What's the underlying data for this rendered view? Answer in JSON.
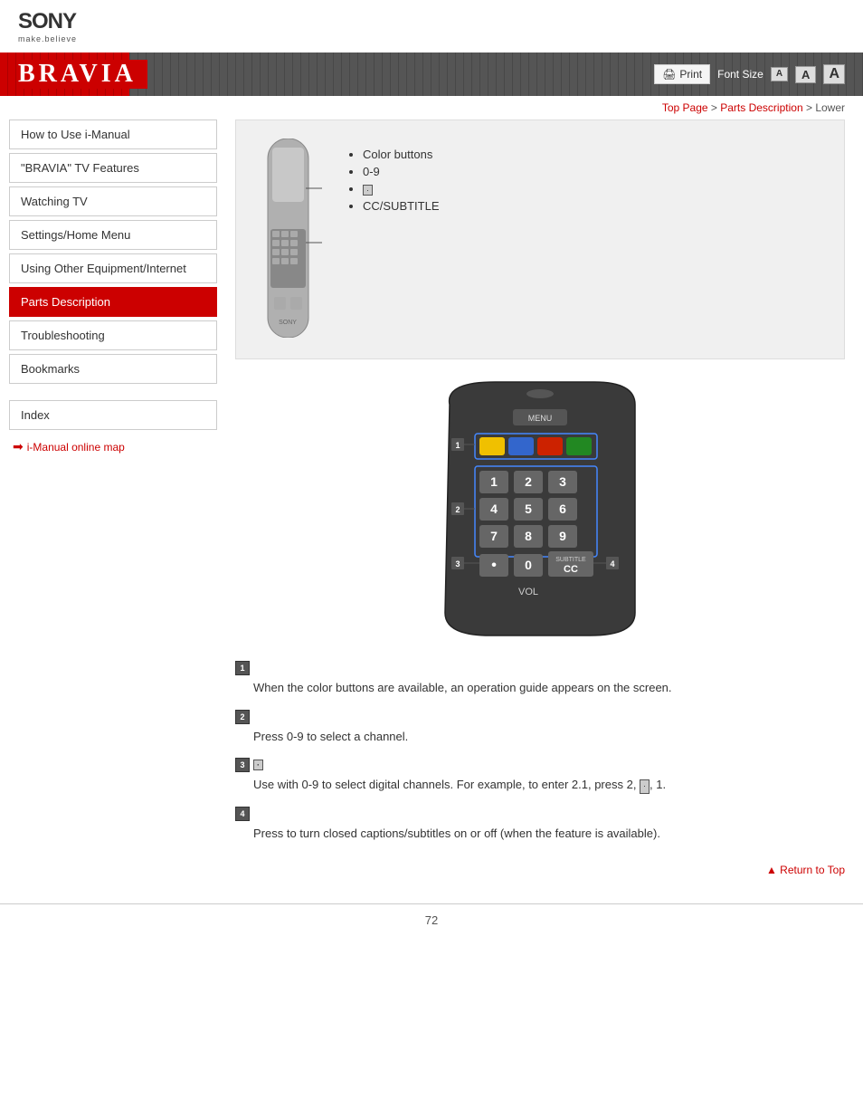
{
  "header": {
    "sony_logo": "SONY",
    "sony_tagline": "make.believe",
    "bravia_title": "BRAVIA"
  },
  "banner_controls": {
    "print_label": "Print",
    "font_size_label": "Font Size",
    "font_small": "A",
    "font_medium": "A",
    "font_large": "A"
  },
  "breadcrumb": {
    "top_page": "Top Page",
    "separator1": " > ",
    "parts_description": "Parts Description",
    "separator2": " > ",
    "current": "Lower"
  },
  "sidebar": {
    "items": [
      {
        "id": "how-to-use",
        "label": "How to Use i-Manual",
        "active": false
      },
      {
        "id": "bravia-features",
        "label": "\"BRAVIA\" TV Features",
        "active": false
      },
      {
        "id": "watching-tv",
        "label": "Watching TV",
        "active": false
      },
      {
        "id": "settings-home",
        "label": "Settings/Home Menu",
        "active": false
      },
      {
        "id": "using-other",
        "label": "Using Other Equipment/Internet",
        "active": false
      },
      {
        "id": "parts-description",
        "label": "Parts Description",
        "active": true
      },
      {
        "id": "troubleshooting",
        "label": "Troubleshooting",
        "active": false
      },
      {
        "id": "bookmarks",
        "label": "Bookmarks",
        "active": false
      }
    ],
    "index_label": "Index",
    "online_map_label": "i-Manual online map"
  },
  "remote_bullets": {
    "items": [
      "Color buttons",
      "0-9",
      "dot_button",
      "CC/SUBTITLE"
    ]
  },
  "descriptions": [
    {
      "number": "1",
      "title_text": "",
      "body": "When the color buttons are available, an operation guide appears on the screen."
    },
    {
      "number": "2",
      "title_text": "",
      "body": "Press 0-9 to select a channel."
    },
    {
      "number": "3",
      "title_text": "dot_icon",
      "body": "Use with 0-9 to select digital channels. For example, to enter 2.1, press 2, [dot], 1."
    },
    {
      "number": "4",
      "title_text": "",
      "body": "Press to turn closed captions/subtitles on or off (when the feature is available)."
    }
  ],
  "return_to_top": "Return to Top",
  "footer": {
    "page_number": "72"
  }
}
